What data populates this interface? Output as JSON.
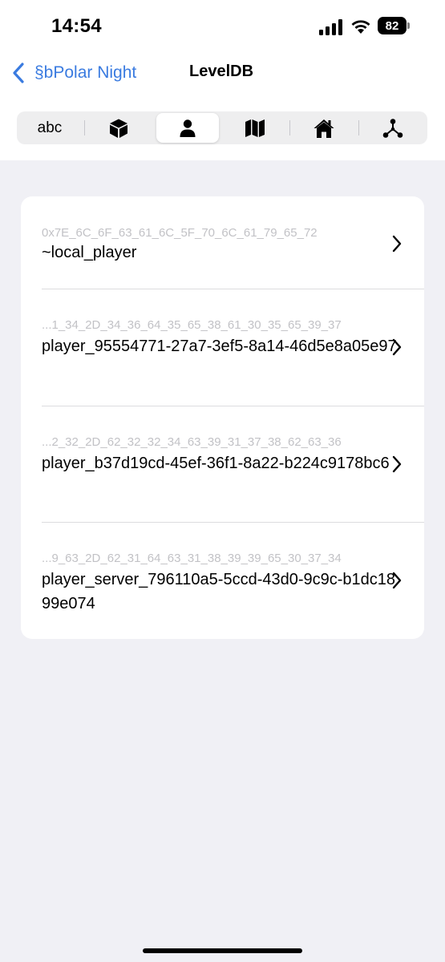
{
  "status_bar": {
    "time": "14:54",
    "battery": "82",
    "icons": [
      "signal-icon",
      "wifi-icon",
      "battery-icon"
    ]
  },
  "nav": {
    "back_label": "§bPolar Night",
    "title": "LevelDB",
    "accent_color": "#3a7be0"
  },
  "segmented": {
    "items": [
      {
        "label": "abc",
        "icon": "text"
      },
      {
        "icon": "cube-icon"
      },
      {
        "icon": "person-icon"
      },
      {
        "icon": "map-icon"
      },
      {
        "icon": "house-icon"
      },
      {
        "icon": "network-icon"
      }
    ],
    "selected_index": 2
  },
  "entries": [
    {
      "key_hex": "0x7E_6C_6F_63_61_6C_5F_70_6C_61_79_65_72",
      "name": "~local_player"
    },
    {
      "key_hex": "...1_34_2D_34_36_64_35_65_38_61_30_35_65_39_37",
      "name": "player_95554771-27a7-3ef5-8a14-46d5e8a05e97"
    },
    {
      "key_hex": "...2_32_2D_62_32_32_34_63_39_31_37_38_62_63_36",
      "name": "player_b37d19cd-45ef-36f1-8a22-b224c9178bc6"
    },
    {
      "key_hex": "...9_63_2D_62_31_64_63_31_38_39_39_65_30_37_34",
      "name": "player_server_796110a5-5ccd-43d0-9c9c-b1dc1899e074"
    }
  ]
}
